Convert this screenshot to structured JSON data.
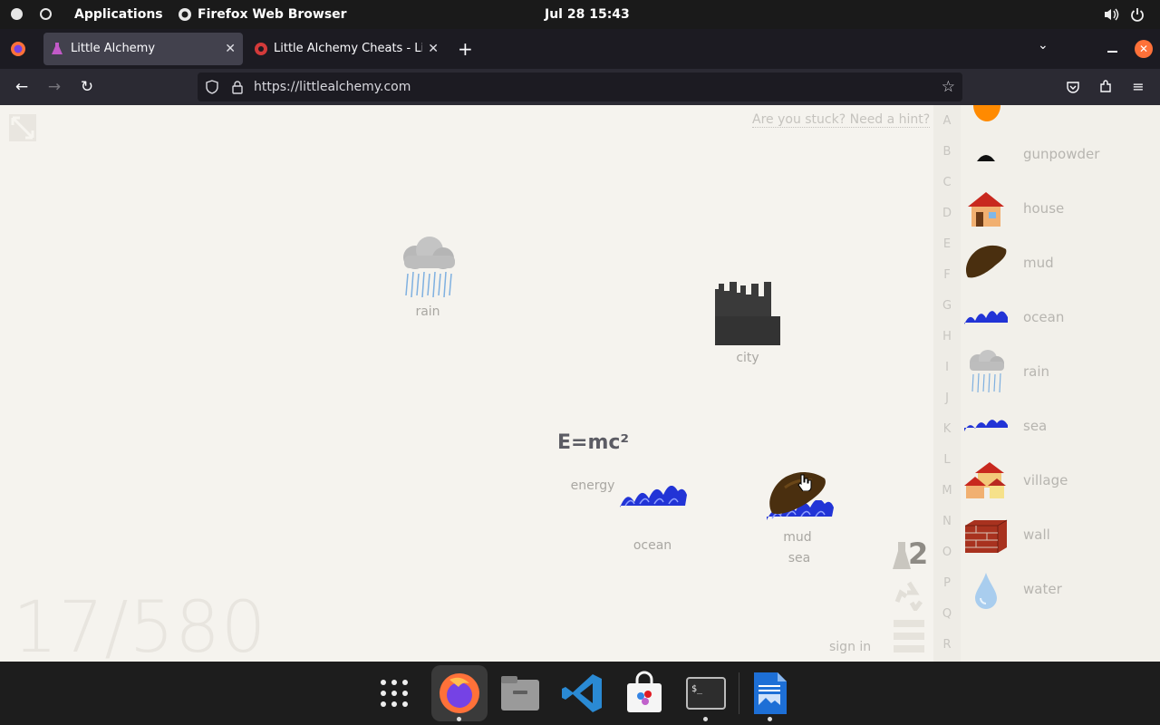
{
  "system": {
    "applications_label": "Applications",
    "active_app_label": "Firefox Web Browser",
    "datetime": "Jul 28  15:43"
  },
  "browser": {
    "tabs": [
      {
        "title": "Little Alchemy",
        "active": true
      },
      {
        "title": "Little Alchemy Cheats - List",
        "active": false
      }
    ],
    "url": "https://littlealchemy.com"
  },
  "game": {
    "hint_link": "Are you stuck? Need a hint?",
    "counter": "17/580",
    "sign_in": "sign in",
    "workspace": {
      "rain_label": "rain",
      "city_label": "city",
      "energy_text": "E=mc²",
      "energy_label": "energy",
      "ocean_label": "ocean",
      "mud_label": "mud",
      "sea_label": "sea"
    },
    "letters": [
      "A",
      "B",
      "C",
      "D",
      "E",
      "F",
      "G",
      "H",
      "I",
      "J",
      "K",
      "L",
      "M",
      "N",
      "O",
      "P",
      "Q",
      "R"
    ],
    "library": [
      {
        "label": "gunpowder",
        "icon": "gunpowder-icon"
      },
      {
        "label": "house",
        "icon": "house-icon"
      },
      {
        "label": "mud",
        "icon": "mud-icon"
      },
      {
        "label": "ocean",
        "icon": "ocean-icon"
      },
      {
        "label": "rain",
        "icon": "rain-icon"
      },
      {
        "label": "sea",
        "icon": "sea-icon"
      },
      {
        "label": "village",
        "icon": "village-icon"
      },
      {
        "label": "wall",
        "icon": "wall-icon"
      },
      {
        "label": "water",
        "icon": "water-icon"
      }
    ],
    "side_tools_badge": "2"
  },
  "colors": {
    "page_bg": "#f5f3ee",
    "ocean_blue": "#2234d6",
    "mud_brown": "#5a3a12",
    "firefox_orange": "#ff7139"
  }
}
